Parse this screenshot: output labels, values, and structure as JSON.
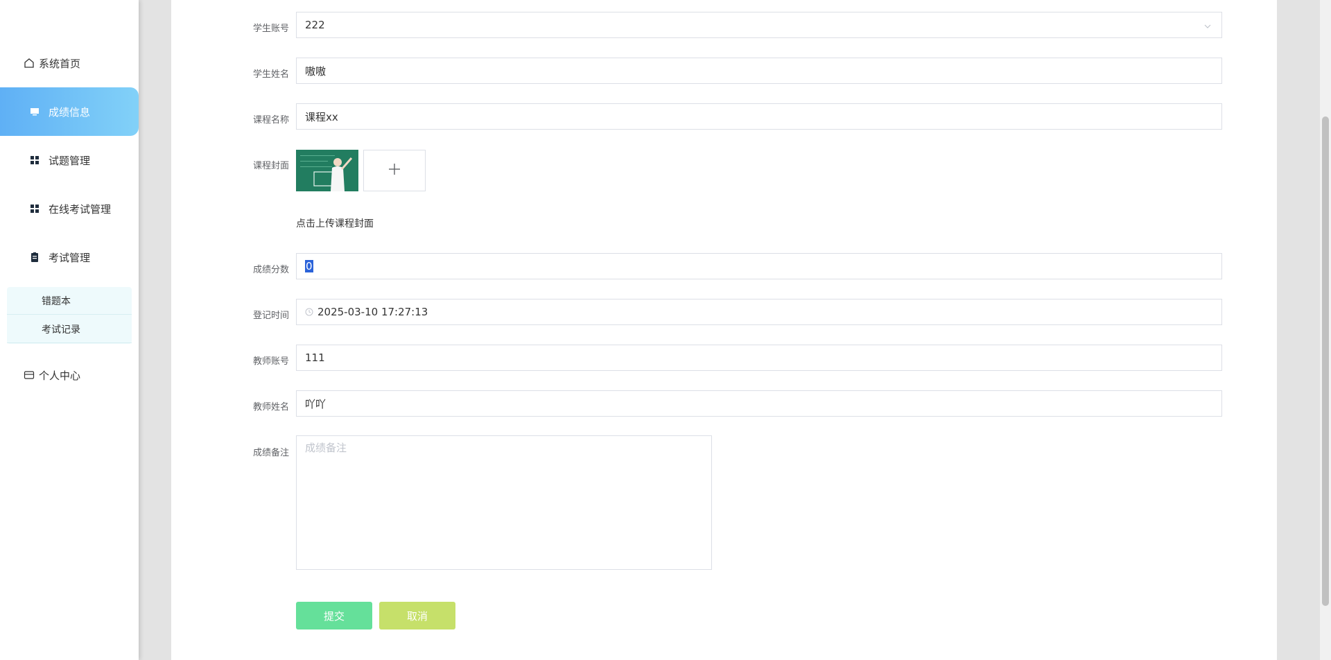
{
  "sidebar": {
    "home": {
      "label": "系统首页",
      "icon": "home-icon"
    },
    "items": [
      {
        "label": "成绩信息",
        "icon": "monitor-icon",
        "active": true
      },
      {
        "label": "试题管理",
        "icon": "grid-icon"
      },
      {
        "label": "在线考试管理",
        "icon": "grid-icon"
      },
      {
        "label": "考试管理",
        "icon": "clipboard-icon"
      }
    ],
    "submenu": [
      {
        "label": "错题本"
      },
      {
        "label": "考试记录"
      }
    ],
    "profile": {
      "label": "个人中心",
      "icon": "card-icon"
    }
  },
  "form": {
    "student_account": {
      "label": "学生账号",
      "value": "222"
    },
    "student_name": {
      "label": "学生姓名",
      "value": "嗷嗷"
    },
    "course_name": {
      "label": "课程名称",
      "value": "课程xx"
    },
    "course_cover": {
      "label": "课程封面",
      "hint": "点击上传课程封面"
    },
    "score": {
      "label": "成绩分数",
      "value": "0"
    },
    "record_time": {
      "label": "登记时间",
      "value": "2025-03-10 17:27:13"
    },
    "teacher_account": {
      "label": "教师账号",
      "value": "111"
    },
    "teacher_name": {
      "label": "教师姓名",
      "value": "吖吖"
    },
    "remark": {
      "label": "成绩备注",
      "placeholder": "成绩备注"
    },
    "submit_label": "提交",
    "cancel_label": "取消"
  },
  "colors": {
    "active_nav": "#5fb0f5",
    "submit": "#65e09a",
    "cancel": "#c6e06a"
  }
}
